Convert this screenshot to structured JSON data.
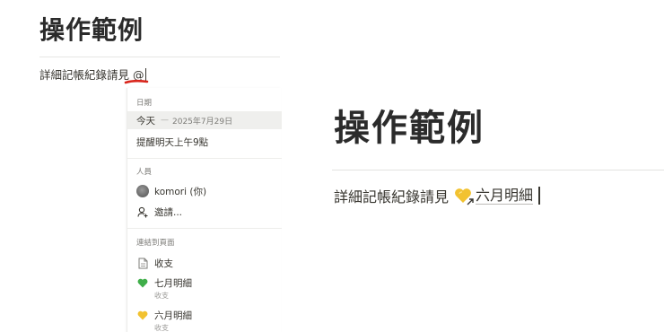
{
  "page": {
    "title": "操作範例",
    "body_text": "詳細記帳紀錄請見",
    "trigger_char": "@"
  },
  "menu": {
    "sections": [
      {
        "heading": "日期",
        "items": [
          {
            "label": "今天",
            "dash": "—",
            "date": "2025年7月29日",
            "selected": true
          },
          {
            "label": "提醒明天上午9點"
          }
        ]
      },
      {
        "heading": "人員",
        "items": [
          {
            "label": "komori (你)",
            "icon": "avatar"
          },
          {
            "label": "邀請...",
            "icon": "invite-person-icon"
          }
        ]
      },
      {
        "heading": "連結到頁面",
        "items": [
          {
            "label": "收支",
            "icon": "page-icon"
          },
          {
            "label": "七月明細",
            "sub": "收支",
            "icon": "green-heart-icon"
          },
          {
            "label": "六月明細",
            "sub": "收支",
            "icon": "yellow-heart-icon"
          }
        ]
      }
    ]
  },
  "result": {
    "title": "操作範例",
    "body_text": "詳細記帳紀錄請見",
    "mention_label": "六月明細",
    "mention_icon": "yellow-heart-icon"
  },
  "colors": {
    "green_heart": "#3fae49",
    "yellow_heart": "#f2c230",
    "red_mark": "#d9261c",
    "selected_bg": "#efefed"
  }
}
